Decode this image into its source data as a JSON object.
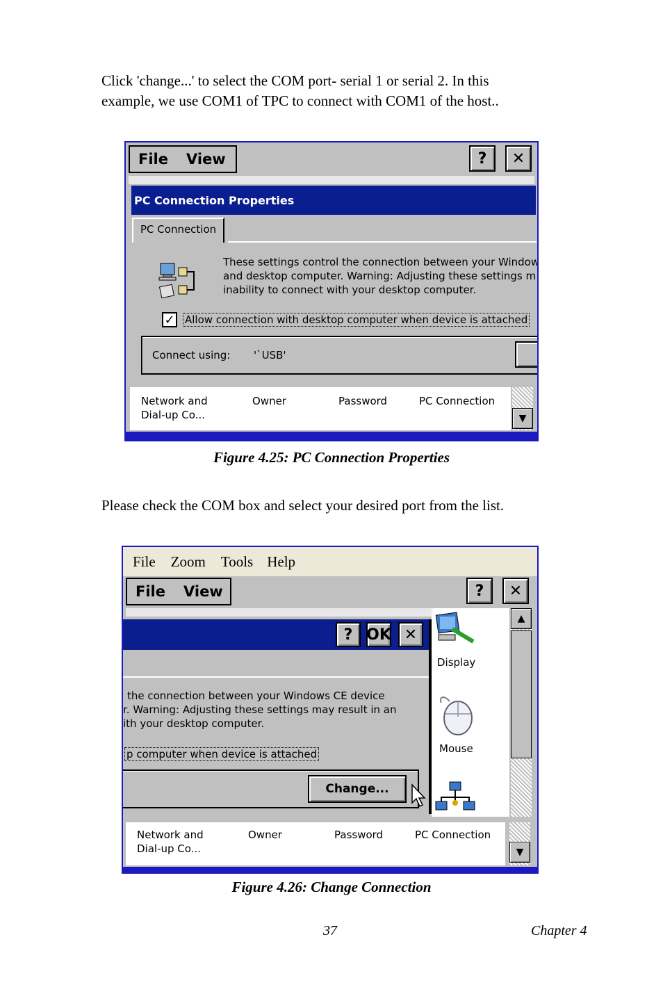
{
  "intro1": {
    "line1": "Click  'change...' to select the COM port- serial 1 or serial 2.  In this",
    "line2": "example, we use COM1 of TPC to connect with COM1 of the host.."
  },
  "shot1": {
    "menu_file": "File",
    "menu_view": "View",
    "help_btn": "?",
    "close_btn": "✕",
    "dialog_title": "PC Connection Properties",
    "tab_label": "PC Connection",
    "desc_line1": "These settings control the connection between your Window",
    "desc_line2": "and desktop computer.  Warning: Adjusting these settings m",
    "desc_line3": "inability to connect with your desktop computer.",
    "checkbox_mark": "✓",
    "checkbox_label": "Allow connection with desktop computer when device is attached",
    "connect_label": "Connect using:",
    "connect_value": "'`USB'",
    "cp_items": [
      {
        "line1": "Network and",
        "line2": "Dial-up Co..."
      },
      {
        "line1": "Owner",
        "line2": ""
      },
      {
        "line1": "Password",
        "line2": ""
      },
      {
        "line1": "PC Connection",
        "line2": ""
      }
    ],
    "scroll_down": "▼"
  },
  "caption1": "Figure 4.25: PC Connection Properties",
  "intro2": "Please check the COM box and select your desired port from the list.",
  "shot2": {
    "menu_top": [
      "File",
      "Zoom",
      "Tools",
      "Help"
    ],
    "menu_file": "File",
    "menu_view": "View",
    "help_btn": "?",
    "close_btn": "✕",
    "dlg_help": "?",
    "dlg_ok": "OK",
    "dlg_close": "✕",
    "desc_line1": " the connection between your Windows CE device",
    "desc_line2": "r.  Warning: Adjusting these settings may result in an",
    "desc_line3": "ith your desktop computer.",
    "checkbox_tail": "p computer when device is attached",
    "change_btn": "Change...",
    "side_icons": [
      "Display",
      "Mouse"
    ],
    "cp_items": [
      {
        "line1": "Network and",
        "line2": "Dial-up Co..."
      },
      {
        "line1": "Owner",
        "line2": ""
      },
      {
        "line1": "Password",
        "line2": ""
      },
      {
        "line1": "PC Connection",
        "line2": ""
      }
    ],
    "scroll_up": "▲",
    "scroll_down": "▼"
  },
  "caption2": "Figure 4.26: Change Connection",
  "footer": {
    "page": "37",
    "chapter": "Chapter 4"
  }
}
